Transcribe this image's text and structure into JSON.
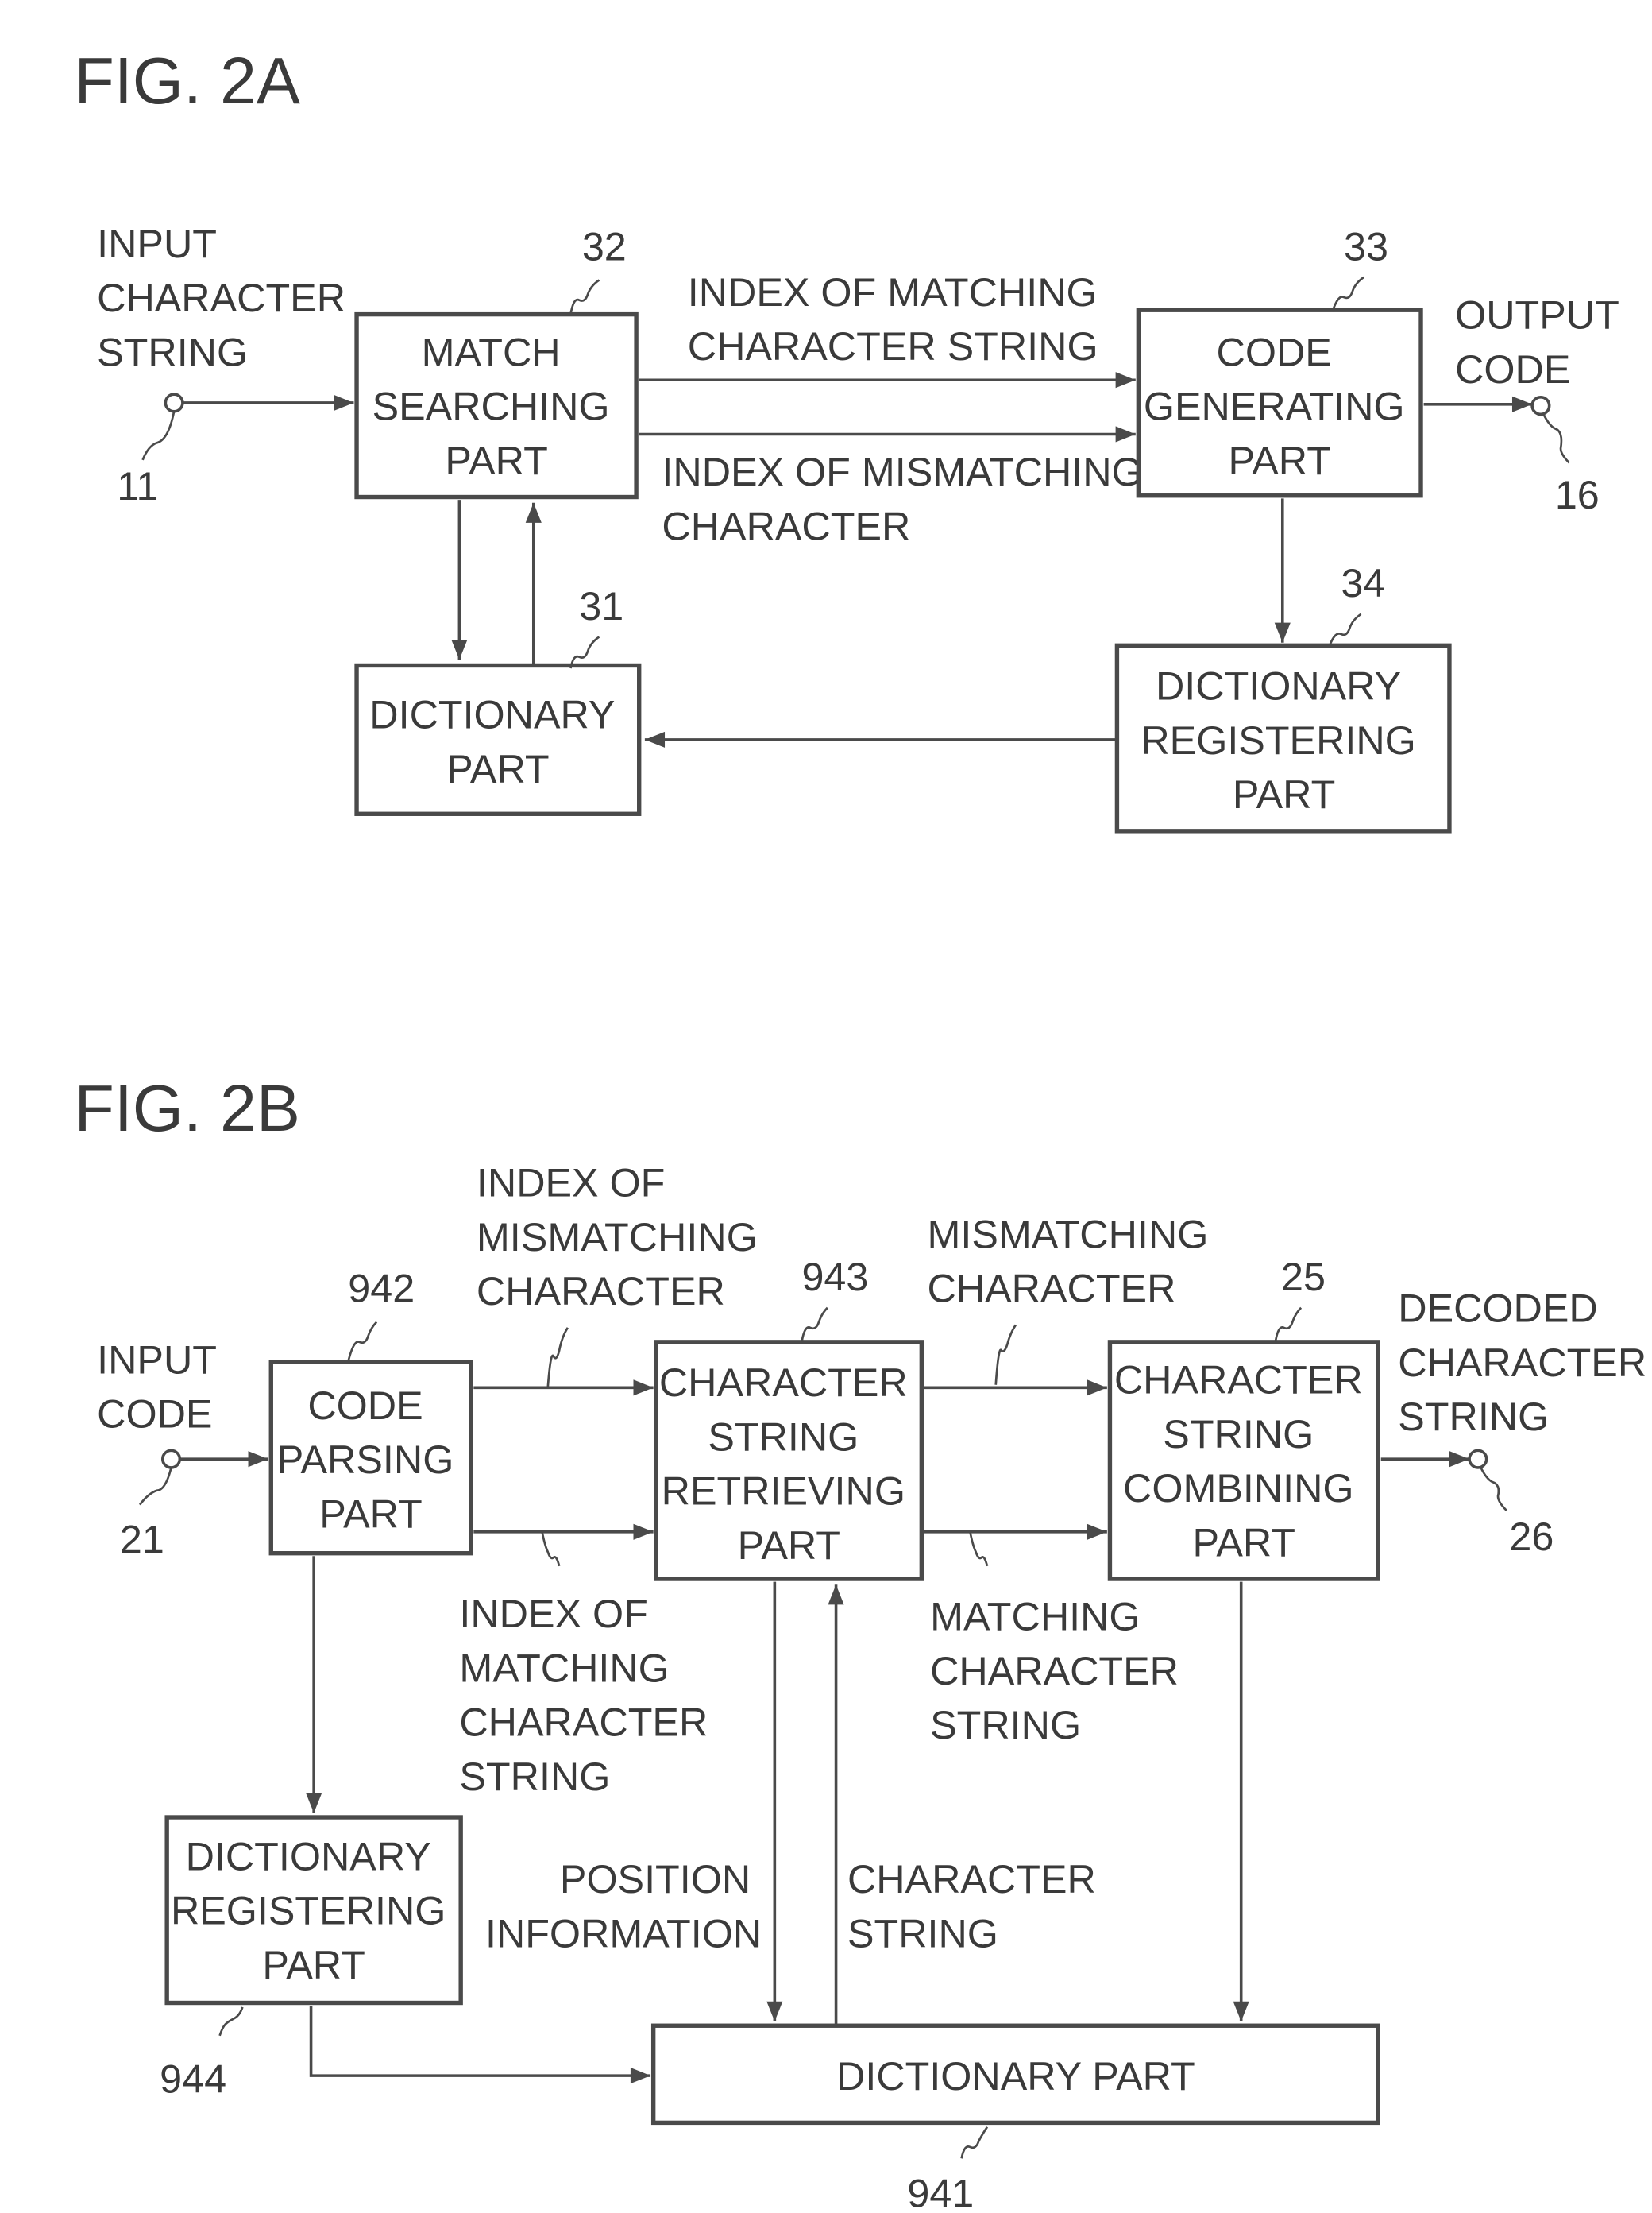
{
  "fig2a": {
    "title": "FIG. 2A",
    "input_label": [
      "INPUT",
      "CHARACTER",
      "STRING"
    ],
    "input_ref": "11",
    "output_label": [
      "OUTPUT",
      "CODE"
    ],
    "output_ref": "16",
    "blocks": {
      "match_searching": {
        "ref": "32",
        "lines": [
          "MATCH",
          "SEARCHING",
          "PART"
        ]
      },
      "code_generating": {
        "ref": "33",
        "lines": [
          "CODE",
          "GENERATING",
          "PART"
        ]
      },
      "dictionary": {
        "ref": "31",
        "lines": [
          "DICTIONARY",
          "PART"
        ]
      },
      "dictionary_registering": {
        "ref": "34",
        "lines": [
          "DICTIONARY",
          "REGISTERING",
          "PART"
        ]
      }
    },
    "signals": {
      "matching": [
        "INDEX OF MATCHING",
        "CHARACTER STRING"
      ],
      "mismatching": [
        "INDEX OF MISMATCHING",
        "CHARACTER"
      ]
    }
  },
  "fig2b": {
    "title": "FIG. 2B",
    "input_label": [
      "INPUT",
      "CODE"
    ],
    "input_ref": "21",
    "output_label": [
      "DECODED",
      "CHARACTER",
      "STRING"
    ],
    "output_ref": "26",
    "blocks": {
      "code_parsing": {
        "ref": "942",
        "lines": [
          "CODE",
          "PARSING",
          "PART"
        ]
      },
      "string_retrieving": {
        "ref": "943",
        "lines": [
          "CHARACTER",
          "STRING",
          "RETRIEVING",
          "PART"
        ]
      },
      "string_combining": {
        "ref": "25",
        "lines": [
          "CHARACTER",
          "STRING",
          "COMBINING",
          "PART"
        ]
      },
      "dictionary_registering": {
        "ref": "944",
        "lines": [
          "DICTIONARY",
          "REGISTERING",
          "PART"
        ]
      },
      "dictionary": {
        "ref": "941",
        "lines": [
          "DICTIONARY PART"
        ]
      }
    },
    "signals": {
      "idx_mismatching": [
        "INDEX OF",
        "MISMATCHING",
        "CHARACTER"
      ],
      "idx_matching": [
        "INDEX OF",
        "MATCHING",
        "CHARACTER",
        "STRING"
      ],
      "mismatching_char": [
        "MISMATCHING",
        "CHARACTER"
      ],
      "matching_string": [
        "MATCHING",
        "CHARACTER",
        "STRING"
      ],
      "position_info": [
        "POSITION",
        "INFORMATION"
      ],
      "char_string": [
        "CHARACTER",
        "STRING"
      ]
    }
  }
}
